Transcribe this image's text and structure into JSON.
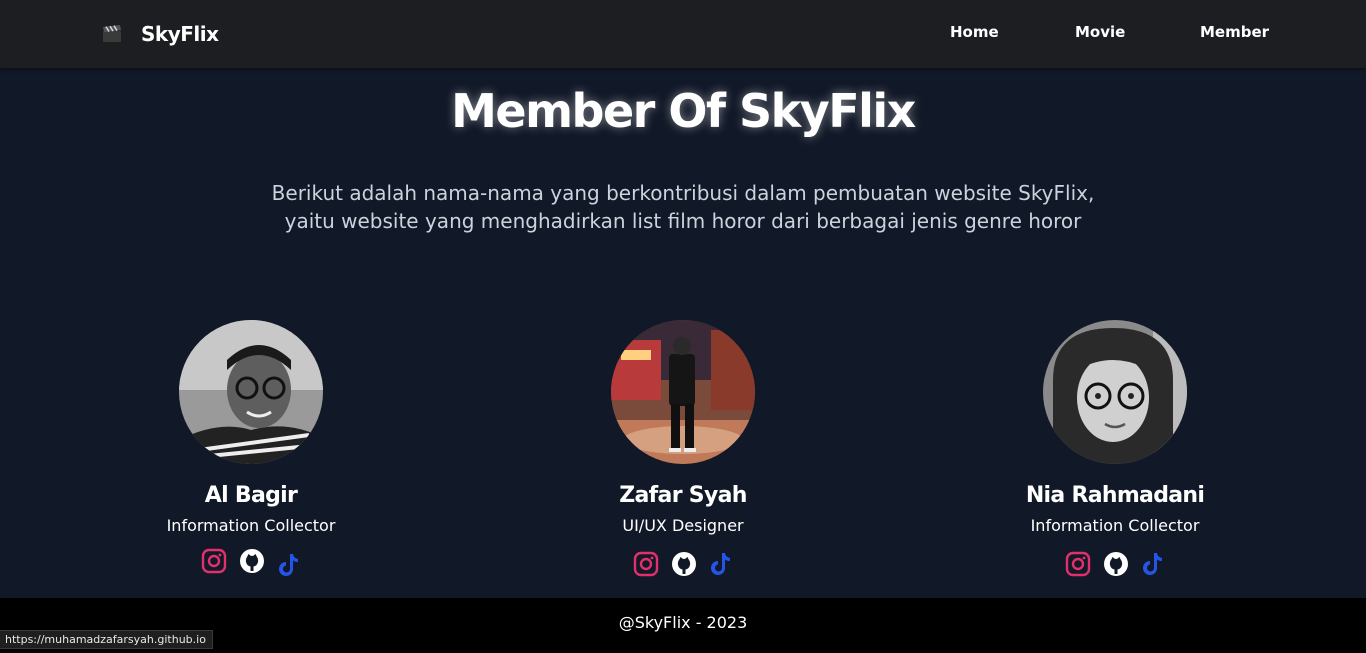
{
  "navbar": {
    "brand_icon": "clapperboard-icon",
    "brand": "SkyFlix",
    "links": [
      "Home",
      "Movie",
      "Member"
    ]
  },
  "page": {
    "title": "Member Of SkyFlix",
    "description": "Berikut adalah nama-nama yang berkontribusi dalam pembuatan website SkyFlix, yaitu website yang menghadirkan list film horor dari berbagai jenis genre horor"
  },
  "members": [
    {
      "name": "Al Bagir",
      "role": "Information Collector",
      "photo": "member-photo-grayscale-boy-with-glasses",
      "socials": [
        "instagram-icon",
        "github-icon",
        "tiktok-icon"
      ]
    },
    {
      "name": "Zafar Syah",
      "role": "UI/UX Designer",
      "photo": "member-photo-color-full-body",
      "socials": [
        "instagram-icon",
        "github-icon",
        "tiktok-icon"
      ]
    },
    {
      "name": "Nia Rahmadani",
      "role": "Information Collector",
      "photo": "member-photo-grayscale-woman-hijab-glasses",
      "socials": [
        "instagram-icon",
        "github-icon",
        "tiktok-icon"
      ]
    }
  ],
  "footer": {
    "text": "@SkyFlix - 2023"
  },
  "status_bar": {
    "url": "https://muhamadzafarsyah.github.io"
  },
  "colors": {
    "background": "#111827",
    "navbar": "#1c1e21",
    "footer": "#000000",
    "instagram": "#e1306c",
    "tiktok": "#2554e8",
    "github": "#ffffff"
  }
}
